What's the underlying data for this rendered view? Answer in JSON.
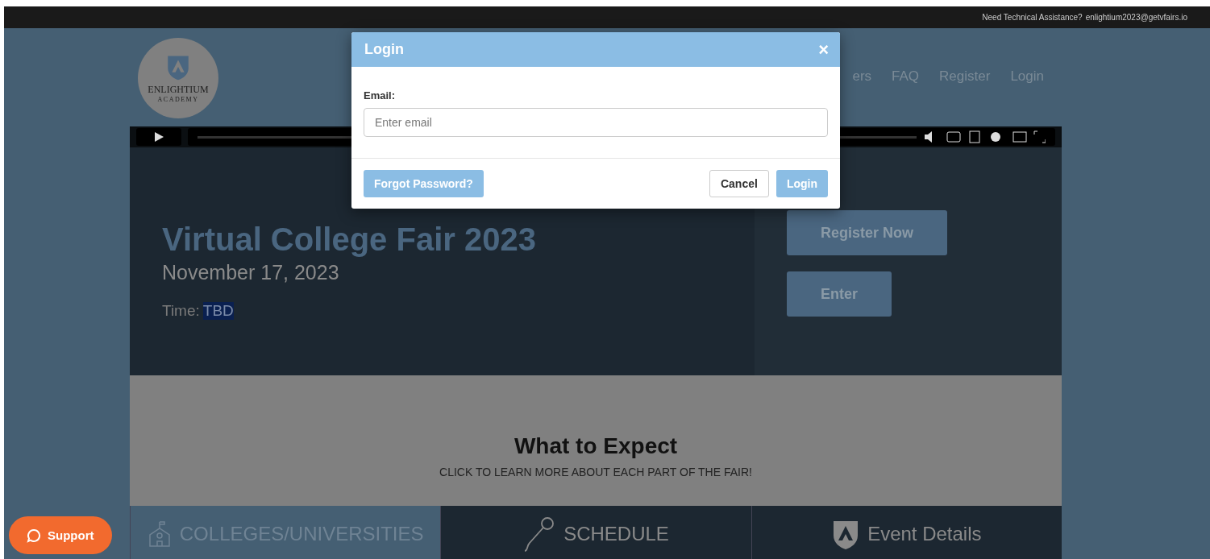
{
  "top_bar": {
    "text": "Need Technical Assistance?",
    "email": "enlightium2023@getvfairs.io"
  },
  "logo": {
    "name": "ENLIGHTIUM",
    "subtitle": "ACADEMY"
  },
  "nav": [
    {
      "label": "ers"
    },
    {
      "label": "FAQ"
    },
    {
      "label": "Register"
    },
    {
      "label": "Login"
    }
  ],
  "hero": {
    "title": "Virtual College Fair 2023",
    "date": "November 17, 2023",
    "time_label": "Time:",
    "time_value": "TBD",
    "buttons": [
      "Register Now",
      "Enter"
    ]
  },
  "expect": {
    "title": "What to Expect",
    "subtitle": "CLICK TO LEARN MORE ABOUT EACH PART OF THE FAIR!"
  },
  "sections": [
    {
      "kind": "school",
      "label": "COLLEGES/UNIVERSITIES",
      "selected": true
    },
    {
      "kind": "mic",
      "label": "SCHEDULE",
      "selected": false
    },
    {
      "kind": "shield",
      "label": "Event Details",
      "selected": false
    }
  ],
  "support": {
    "label": "Support"
  },
  "video": {
    "level": 0
  },
  "modal": {
    "title": "Login",
    "close": "×",
    "field_label": "Email:",
    "placeholder": "Enter email",
    "forgot": "Forgot Password?",
    "cancel": "Cancel",
    "submit": "Login"
  }
}
